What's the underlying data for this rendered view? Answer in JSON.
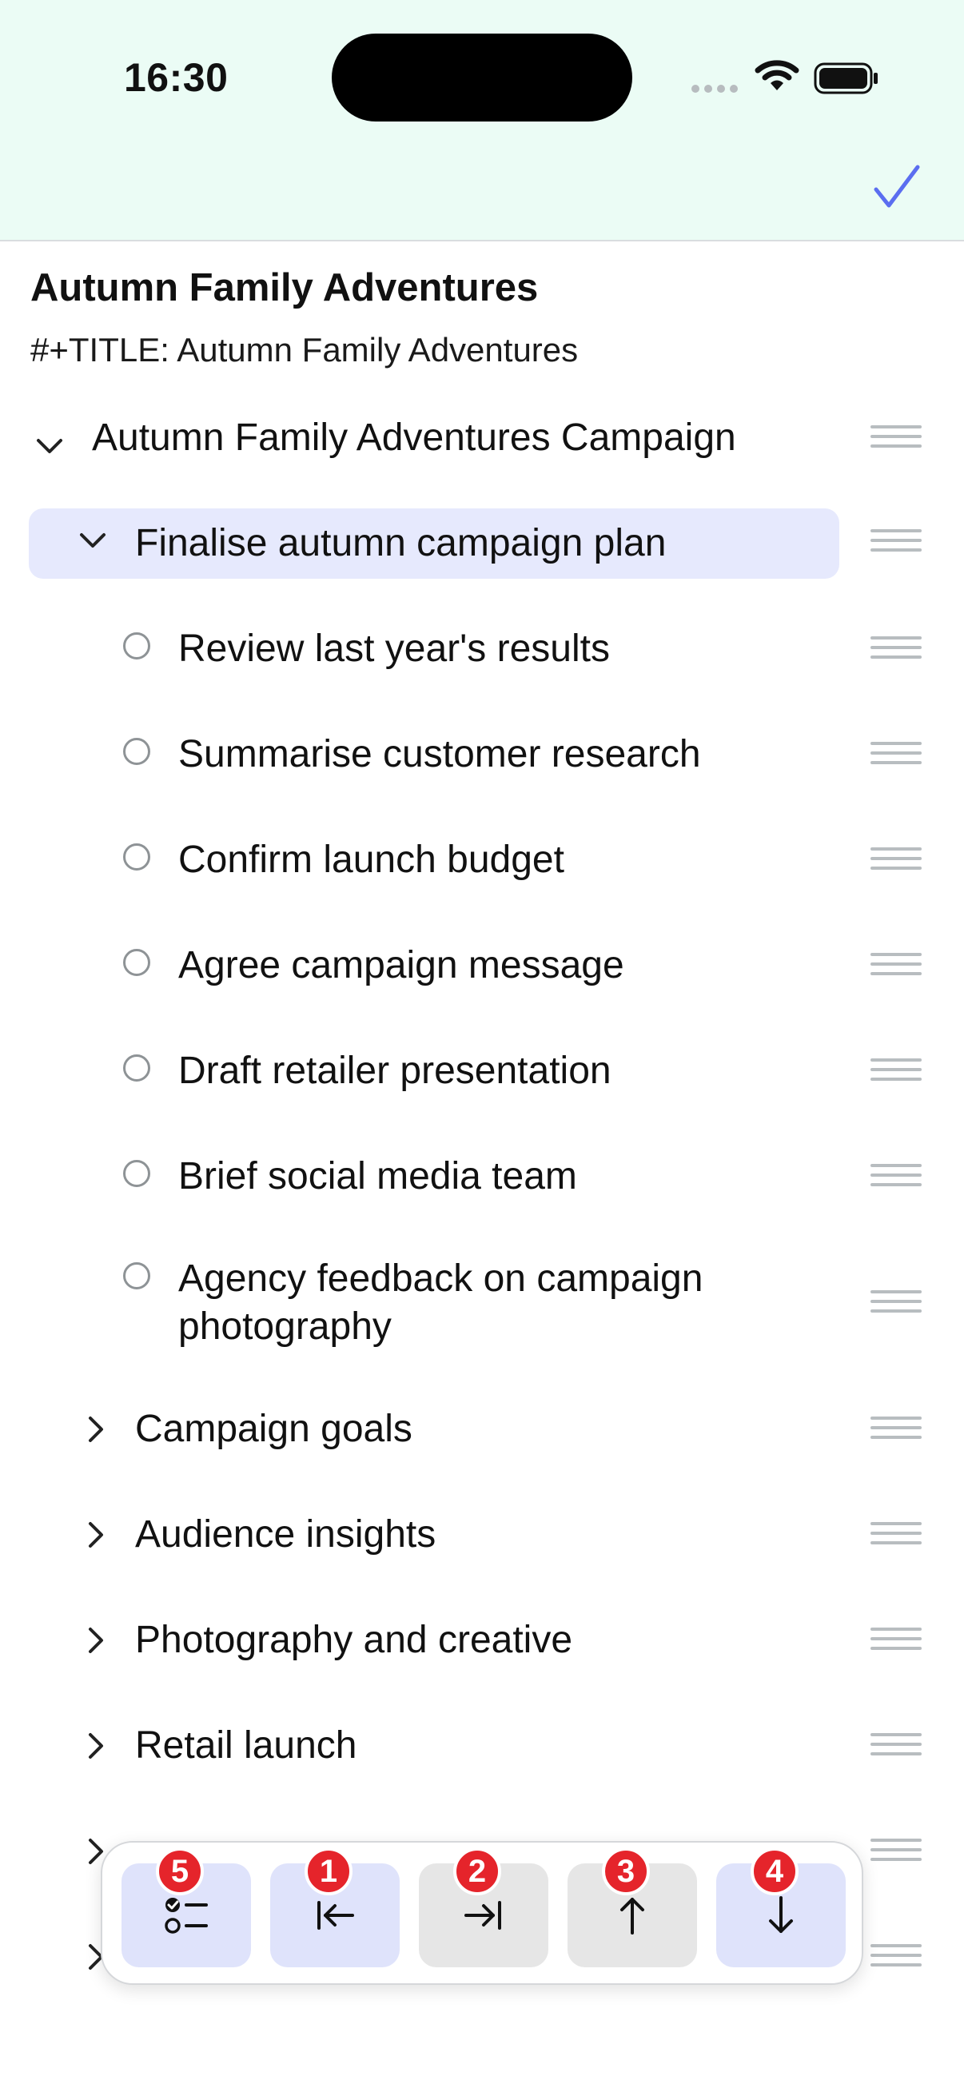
{
  "status_bar": {
    "time": "16:30"
  },
  "document": {
    "title": "Autumn Family Adventures",
    "meta_line": "#+TITLE: Autumn Family Adventures"
  },
  "outline": [
    {
      "label": "Autumn Family Adventures Campaign",
      "kind": "expanded",
      "level": 0
    },
    {
      "label": "Finalise autumn campaign plan",
      "kind": "expanded",
      "level": 1,
      "selected": true
    },
    {
      "label": "Review last year's results",
      "kind": "todo",
      "level": 2
    },
    {
      "label": "Summarise customer research",
      "kind": "todo",
      "level": 2
    },
    {
      "label": "Confirm launch budget",
      "kind": "todo",
      "level": 2
    },
    {
      "label": "Agree campaign message",
      "kind": "todo",
      "level": 2
    },
    {
      "label": "Draft retailer presentation",
      "kind": "todo",
      "level": 2
    },
    {
      "label": "Brief social media team",
      "kind": "todo",
      "level": 2
    },
    {
      "label": "Agency feedback on campaign photography",
      "kind": "todo",
      "level": 2
    },
    {
      "label": "Campaign goals",
      "kind": "collapsed",
      "level": 1
    },
    {
      "label": "Audience insights",
      "kind": "collapsed",
      "level": 1
    },
    {
      "label": "Photography and creative",
      "kind": "collapsed",
      "level": 1
    },
    {
      "label": "Retail launch",
      "kind": "collapsed",
      "level": 1
    }
  ],
  "toolbar": {
    "buttons": [
      {
        "icon": "checklist-icon",
        "badge": "5",
        "state": "active"
      },
      {
        "icon": "outdent-icon",
        "badge": "1",
        "state": "active"
      },
      {
        "icon": "indent-icon",
        "badge": "2",
        "state": "inactive"
      },
      {
        "icon": "move-up-icon",
        "badge": "3",
        "state": "inactive"
      },
      {
        "icon": "move-down-icon",
        "badge": "4",
        "state": "active"
      }
    ]
  },
  "colors": {
    "header_bg": "#ebfcf5",
    "accent": "#5b6ef0",
    "selected_row": "#e6e9fd",
    "badge": "#e5242b"
  }
}
